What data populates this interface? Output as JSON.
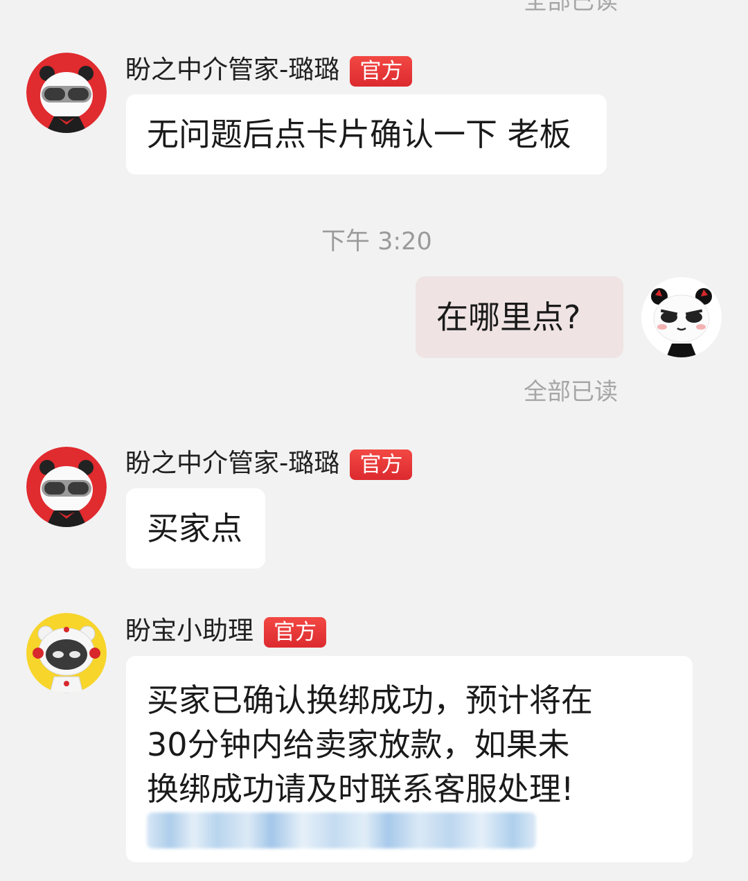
{
  "top": {
    "read_status": "全部已读"
  },
  "messages": [
    {
      "sender": "盼之中介管家-璐璐",
      "badge": "官方",
      "text": "无问题后点卡片确认一下 老板"
    },
    {
      "time": "下午 3:20"
    },
    {
      "text": "在哪里点?",
      "read_status": "全部已读"
    },
    {
      "sender": "盼之中介管家-璐璐",
      "badge": "官方",
      "text": "买家点"
    },
    {
      "sender": "盼宝小助理",
      "badge": "官方",
      "lines": [
        "买家已确认换绑成功，预计将在",
        "30分钟内给卖家放款，如果未",
        "换绑成功请及时联系客服处理!"
      ]
    }
  ],
  "colors": {
    "background": "#f2f2f2",
    "badge": "#e0312f",
    "my_bubble": "#efe3e3",
    "agent_avatar_bg": "#e02b2f",
    "assistant_avatar_bg": "#f7d52a"
  },
  "icons": {
    "agent_avatar": "panda-goggles-avatar",
    "my_avatar": "panda-avatar",
    "assistant_avatar": "panda-astronaut-avatar"
  }
}
